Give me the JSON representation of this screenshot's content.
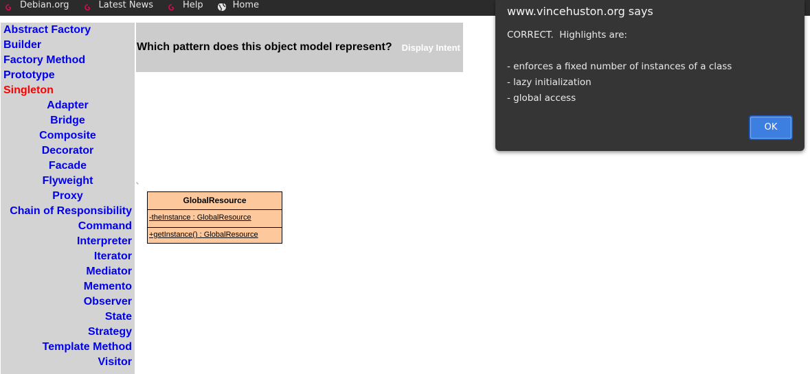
{
  "bookmarks": [
    {
      "label": "Debian.org",
      "icon": "debian-swirl-icon"
    },
    {
      "label": "Latest News",
      "icon": "debian-swirl-icon"
    },
    {
      "label": "Help",
      "icon": "debian-swirl-icon"
    },
    {
      "label": "Home",
      "icon": "globe-icon"
    }
  ],
  "nav": {
    "creational": [
      "Abstract Factory",
      "Builder",
      "Factory Method",
      "Prototype",
      "Singleton"
    ],
    "structural": [
      "Adapter",
      "Bridge",
      "Composite",
      "Decorator",
      "Facade",
      "Flyweight",
      "Proxy"
    ],
    "behavioral": [
      "Chain of Responsibility",
      "Command",
      "Interpreter",
      "Iterator",
      "Mediator",
      "Memento",
      "Observer",
      "State",
      "Strategy",
      "Template Method",
      "Visitor"
    ],
    "active": "Singleton"
  },
  "question": {
    "text": "Which pattern does this object model represent?",
    "intent_link": "Display Intent"
  },
  "uml": {
    "class_name": "GlobalResource",
    "attribute": "-theInstance : GlobalResource",
    "operation": "+getInstance() : GlobalResource"
  },
  "dialog": {
    "origin": "www.vincehuston.org says",
    "message": "CORRECT.  Highlights are:\n\n- enforces a fixed number of instances of a class\n- lazy initialization\n- global access",
    "ok_label": "OK"
  },
  "colors": {
    "toolbar_bg": "#2b2b2b",
    "nav_bg": "#d3d3d3",
    "link": "#0000ee",
    "active_link": "#ff0000",
    "uml_fill": "#fcc89c",
    "dialog_bg": "#353535",
    "ok_button": "#3d7fe0"
  }
}
